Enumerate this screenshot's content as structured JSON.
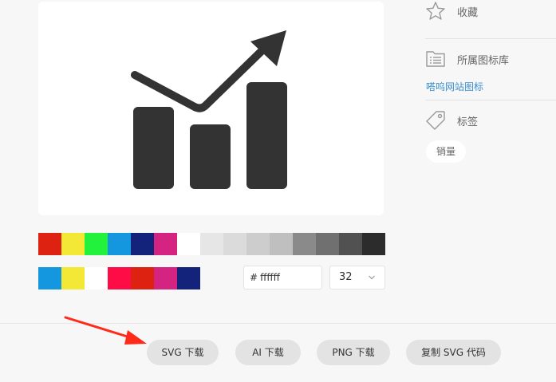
{
  "preview": {
    "icon": "sales-growth-chart-icon",
    "icon_color": "#333333",
    "background": "#ffffff"
  },
  "sidebar": {
    "favorite": {
      "icon": "star-icon",
      "label": "收藏"
    },
    "library": {
      "icon": "library-icon",
      "label": "所属图标库",
      "link": "嗒呜网站图标"
    },
    "tags": {
      "icon": "tag-icon",
      "label": "标签",
      "items": [
        "销量"
      ]
    }
  },
  "palette_row1": [
    "#dd2211",
    "#f4e836",
    "#22f23b",
    "#1597e0",
    "#13227a",
    "#d42380",
    "#ffffff",
    "#e6e6e6",
    "#dbdbdb",
    "#cdcdcd",
    "#bfbfbf",
    "#8a8a8a",
    "#707070",
    "#515151",
    "#2c2c2c"
  ],
  "palette_row2": [
    "#1597e0",
    "#f4e836",
    "#ffffff",
    "#fe0c45",
    "#dd2211",
    "#d42380",
    "#13227a"
  ],
  "color_input": {
    "hash": "#",
    "value": "ffffff"
  },
  "size_select": {
    "value": "32",
    "chevron": "chevron-down-icon"
  },
  "buttons": {
    "svg": "SVG 下载",
    "ai": "AI 下载",
    "png": "PNG 下载",
    "copy": "复制 SVG 代码"
  },
  "annotation": {
    "arrow_color": "#ff2a1a"
  }
}
